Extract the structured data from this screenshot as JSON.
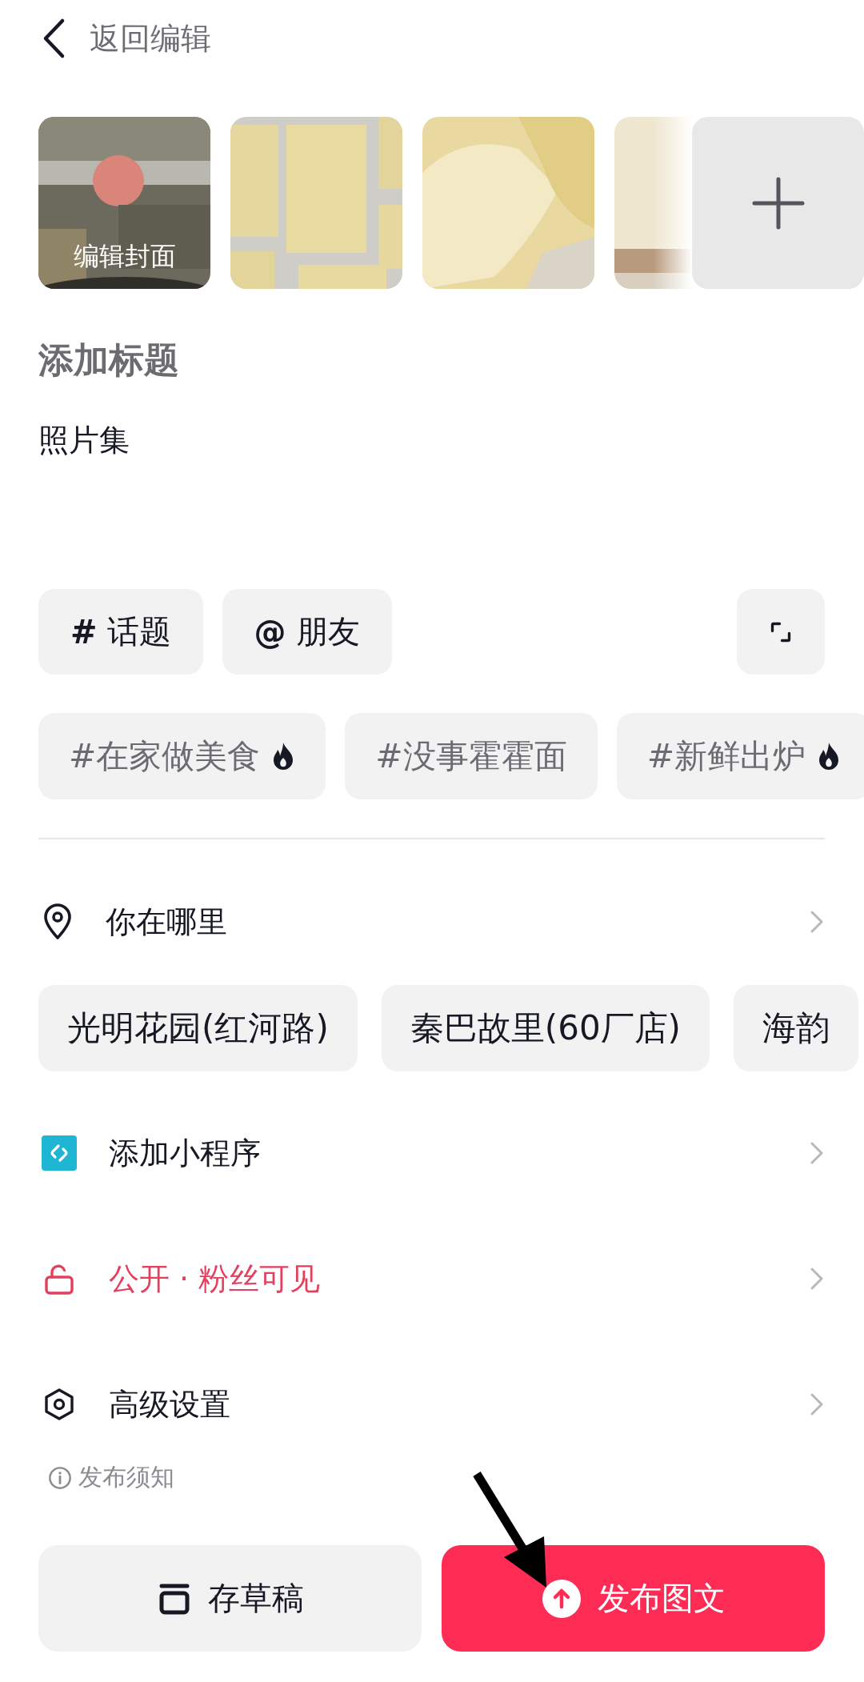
{
  "header": {
    "back_label": "返回编辑"
  },
  "photos": [
    {
      "kind": "picture",
      "caption": "编辑封面"
    },
    {
      "kind": "picture"
    },
    {
      "kind": "picture"
    },
    {
      "kind": "picture"
    }
  ],
  "title_field": {
    "placeholder": "添加标题"
  },
  "description_field": {
    "value": "照片集"
  },
  "insert_buttons": [
    {
      "symbol": "#",
      "label": "话题"
    },
    {
      "symbol": "@",
      "label": "朋友"
    }
  ],
  "suggested_tags": [
    {
      "label": "#在家做美食",
      "hot": true
    },
    {
      "label": "#没事霍霍面",
      "hot": false
    },
    {
      "label": "#新鲜出炉",
      "hot": true
    }
  ],
  "location": {
    "label": "你在哪里",
    "suggestions": [
      "光明花园(红河路)",
      "秦巴故里(60厂店)",
      "海韵"
    ]
  },
  "menu": [
    {
      "kind": "mini_program",
      "label": "添加小程序"
    },
    {
      "kind": "privacy",
      "label": "公开 · 粉丝可见"
    },
    {
      "kind": "advanced",
      "label": "高级设置"
    }
  ],
  "notice": "发布须知",
  "buttons": [
    {
      "kind": "draft",
      "label": "存草稿"
    },
    {
      "kind": "publish",
      "label": "发布图文"
    }
  ]
}
